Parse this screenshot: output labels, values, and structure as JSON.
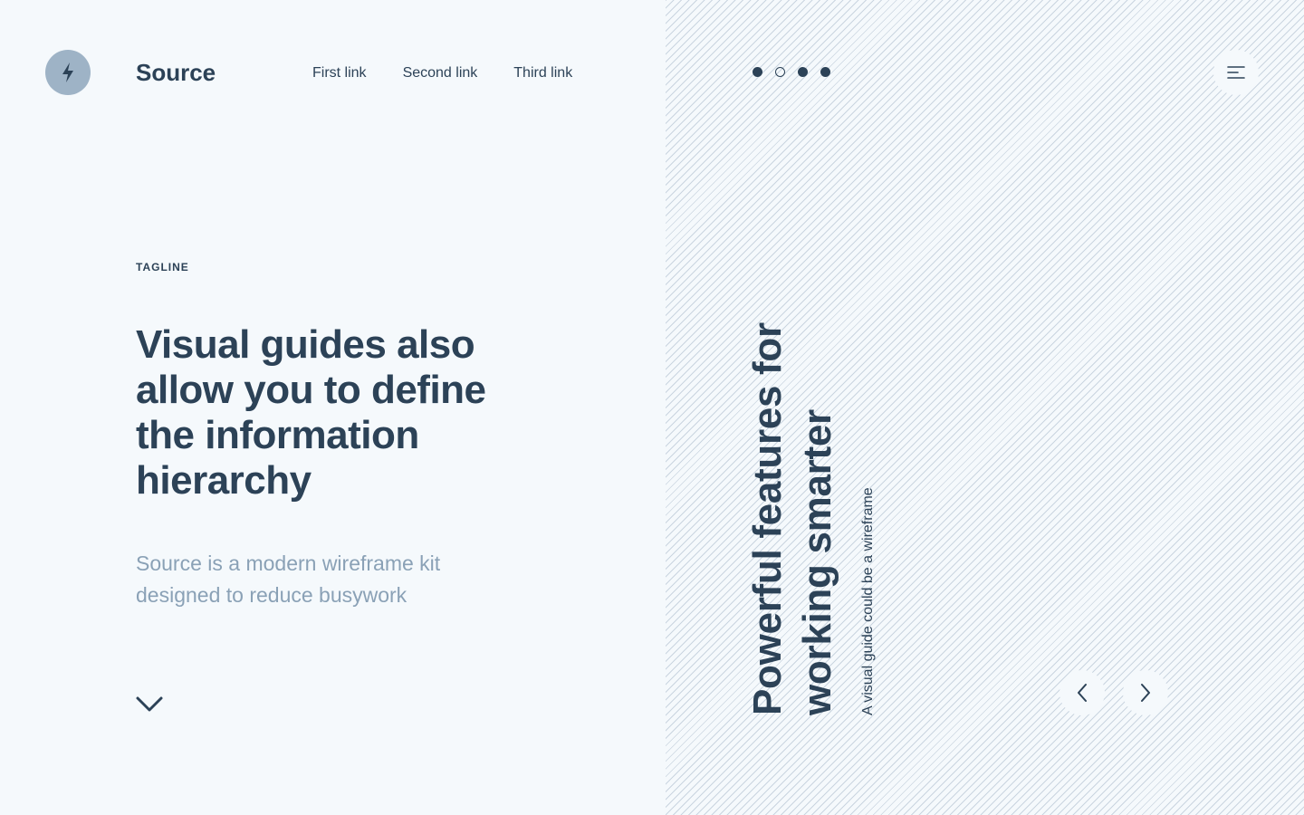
{
  "header": {
    "brand": "Source",
    "logo_icon": "lightning-bolt-icon",
    "nav_links": [
      "First link",
      "Second link",
      "Third link"
    ],
    "menu_icon": "hamburger-menu-icon"
  },
  "hero": {
    "tagline": "TAGLINE",
    "headline": "Visual guides also allow you to define the information hierarchy",
    "subtext": "Source is a modern wireframe kit designed to reduce busywork",
    "scroll_icon": "chevron-down-icon"
  },
  "slider": {
    "pagination": [
      {
        "state": "filled"
      },
      {
        "state": "empty"
      },
      {
        "state": "filled"
      },
      {
        "state": "filled"
      }
    ],
    "title": "Powerful features for working smarter",
    "subtitle": "A visual guide could be a wireframe",
    "prev_icon": "chevron-left-icon",
    "next_icon": "chevron-right-icon"
  },
  "colors": {
    "primary": "#2c4257",
    "muted": "#8aa1b6",
    "logo_bg": "#9eb3c6",
    "background": "#f5f9fc"
  }
}
